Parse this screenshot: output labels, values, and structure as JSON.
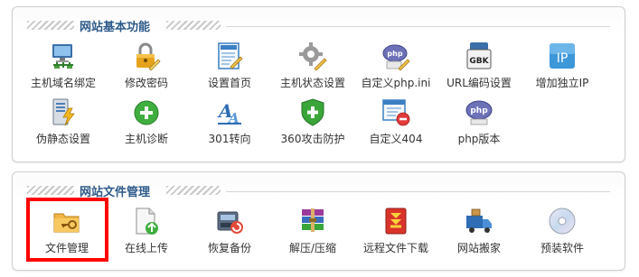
{
  "sections": {
    "basic": {
      "title": "网站基本功能",
      "items": [
        {
          "label": "主机域名绑定",
          "icon": "computer-network-icon"
        },
        {
          "label": "修改密码",
          "icon": "padlock-pencil-icon"
        },
        {
          "label": "设置首页",
          "icon": "document-pencil-icon"
        },
        {
          "label": "主机状态设置",
          "icon": "gear-pencil-icon"
        },
        {
          "label": "自定义php.ini",
          "icon": "php-edit-icon"
        },
        {
          "label": "URL编码设置",
          "icon": "gbk-encoding-icon"
        },
        {
          "label": "增加独立IP",
          "icon": "ip-badge-icon"
        },
        {
          "label": "伪静态设置",
          "icon": "server-lightning-icon"
        },
        {
          "label": "主机诊断",
          "icon": "green-plus-icon"
        },
        {
          "label": "301转向",
          "icon": "redirect-letters-icon"
        },
        {
          "label": "360攻击防护",
          "icon": "shield-plus-icon"
        },
        {
          "label": "自定义404",
          "icon": "window-remove-icon"
        },
        {
          "label": "php版本",
          "icon": "php-version-icon"
        }
      ]
    },
    "files": {
      "title": "网站文件管理",
      "items": [
        {
          "label": "文件管理",
          "icon": "folder-key-icon"
        },
        {
          "label": "在线上传",
          "icon": "document-upload-icon"
        },
        {
          "label": "恢复备份",
          "icon": "backup-restore-icon"
        },
        {
          "label": "解压/压缩",
          "icon": "archive-books-icon"
        },
        {
          "label": "远程文件下载",
          "icon": "download-arrows-icon"
        },
        {
          "label": "网站搬家",
          "icon": "moving-truck-icon"
        },
        {
          "label": "预装软件",
          "icon": "cd-disc-icon"
        }
      ]
    }
  },
  "colors": {
    "title": "#2d5a8a",
    "selection_border": "#ff0000"
  },
  "selected_item": "文件管理"
}
